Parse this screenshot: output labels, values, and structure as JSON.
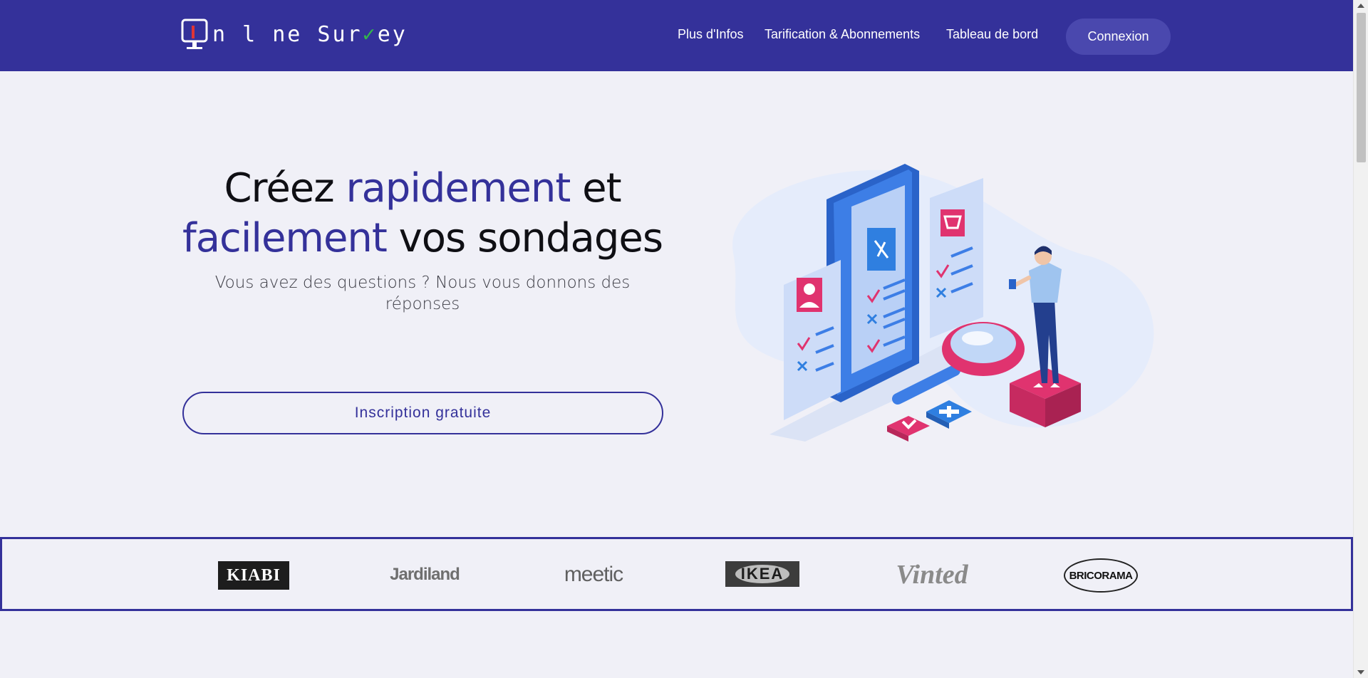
{
  "header": {
    "logo_text": "Online Survey",
    "nav": [
      "Plus d'Infos",
      "Tarification & Abonnements",
      "Tableau de bord"
    ],
    "login_label": "Connexion",
    "color": "#34319a"
  },
  "hero": {
    "title_parts": [
      "Créez ",
      "rapidement",
      " et ",
      "facilement",
      " vos sondages"
    ],
    "subtitle": "Vous avez des questions ? Nous vous donnons des réponses",
    "cta_label": "Inscription gratuite"
  },
  "brands": [
    "KIABI",
    "Jardiland",
    "meetic",
    "IKEA",
    "Vinted",
    "BRICORAMA"
  ],
  "colors": {
    "primary": "#34319a",
    "background": "#f0f0f7",
    "accent_pink": "#e0336f",
    "accent_blue": "#2f7fe0"
  },
  "icons": [
    "monitor-logo-icon",
    "checkmark-logo-icon",
    "survey-phone-illustration"
  ]
}
